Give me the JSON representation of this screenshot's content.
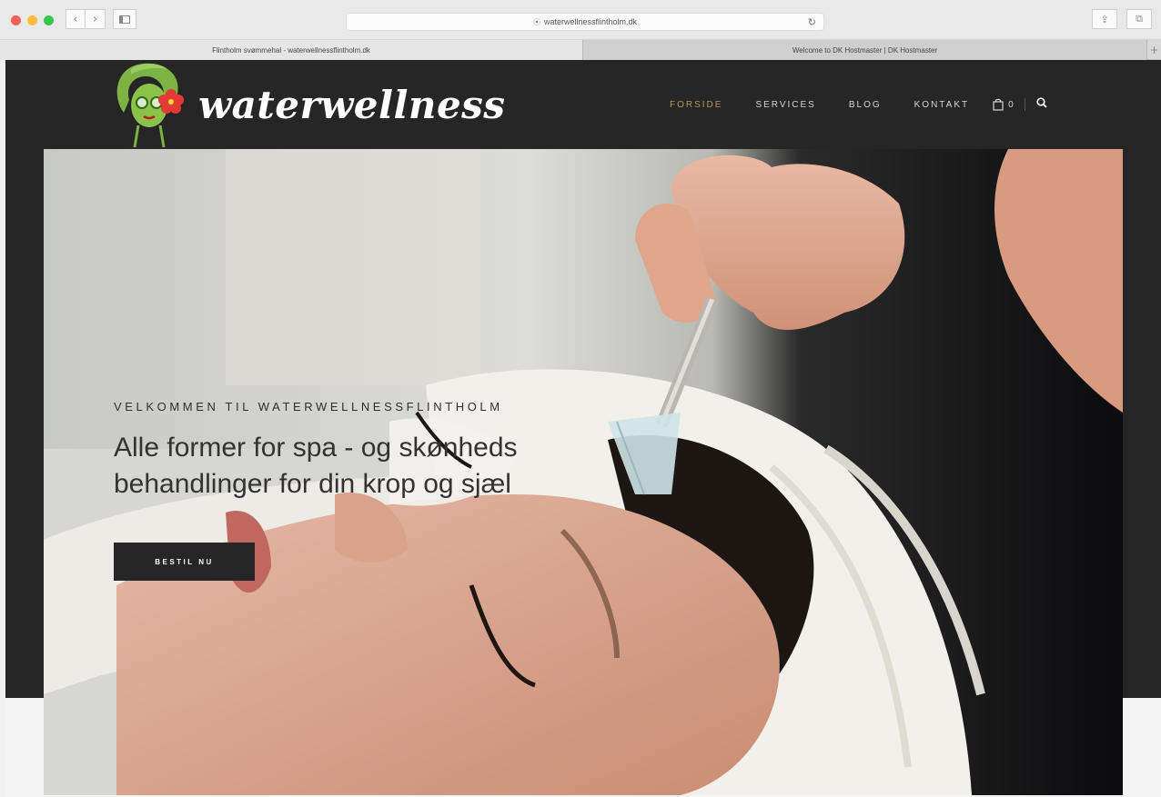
{
  "browser": {
    "url": "waterwellnessflintholm.dk",
    "tabs": [
      {
        "label": "Flintholm svømmehal - waterwellnessflintholm.dk",
        "active": true
      },
      {
        "label": "Welcome to DK Hostmaster | DK Hostmaster",
        "active": false
      }
    ],
    "new_tab_label": "+",
    "traffic_lights": [
      "#fc605b",
      "#fdbc40",
      "#34c84a"
    ]
  },
  "site": {
    "logo_text": "waterwellness",
    "nav": [
      {
        "label": "FORSIDE",
        "active": true
      },
      {
        "label": "SERVICES",
        "active": false
      },
      {
        "label": "BLOG",
        "active": false
      },
      {
        "label": "KONTAKT",
        "active": false
      }
    ],
    "cart_count": "0",
    "colors": {
      "header_bg": "#262627",
      "accent": "#b8954f",
      "logo_green": "#7cb342",
      "flower_red": "#e53935"
    }
  },
  "hero": {
    "eyebrow": "VELKOMMEN TIL WATERWELLNESSFLINTHOLM",
    "headline_line1": "Alle former for spa - og skønheds",
    "headline_line2": "behandlinger for din krop og sjæl",
    "cta_label": "BESTIL NU"
  }
}
